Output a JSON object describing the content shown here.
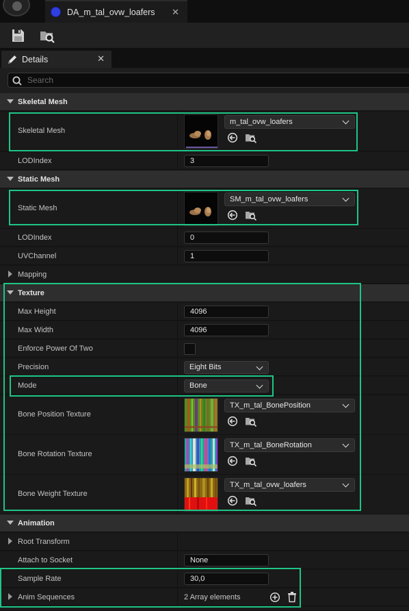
{
  "window": {
    "tab_title": "DA_m_tal_ovw_loafers",
    "close_glyph": "✕"
  },
  "toolbar": {
    "save_icon": "save-icon",
    "browse_icon": "browse-icon"
  },
  "details": {
    "tab_label": "Details",
    "close_glyph": "✕"
  },
  "search": {
    "placeholder": "Search"
  },
  "sections": {
    "skeletal_mesh": {
      "header": "Skeletal Mesh",
      "mesh_label": "Skeletal Mesh",
      "mesh_value": "m_tal_ovw_loafers",
      "lod_label": "LODIndex",
      "lod_value": "3"
    },
    "static_mesh": {
      "header": "Static Mesh",
      "mesh_label": "Static Mesh",
      "mesh_value": "SM_m_tal_ovw_loafers",
      "lod_label": "LODIndex",
      "lod_value": "0",
      "uv_label": "UVChannel",
      "uv_value": "1"
    },
    "mapping": {
      "header": "Mapping"
    },
    "texture": {
      "header": "Texture",
      "max_height_label": "Max Height",
      "max_height_value": "4096",
      "max_width_label": "Max Width",
      "max_width_value": "4096",
      "enforce_label": "Enforce Power Of Two",
      "precision_label": "Precision",
      "precision_value": "Eight Bits",
      "mode_label": "Mode",
      "mode_value": "Bone",
      "bone_pos_label": "Bone Position Texture",
      "bone_pos_value": "TX_m_tal_BonePosition",
      "bone_rot_label": "Bone Rotation Texture",
      "bone_rot_value": "TX_m_tal_BoneRotation",
      "bone_weight_label": "Bone Weight Texture",
      "bone_weight_value": "TX_m_tal_ovw_loafers"
    },
    "animation": {
      "header": "Animation",
      "root_label": "Root Transform",
      "attach_label": "Attach to Socket",
      "attach_value": "None",
      "sample_label": "Sample Rate",
      "sample_value": "30,0",
      "anim_label": "Anim Sequences",
      "anim_value": "2 Array elements"
    }
  },
  "colors": {
    "highlight": "#1ec587",
    "asset_icon": "#2f3fe0"
  }
}
